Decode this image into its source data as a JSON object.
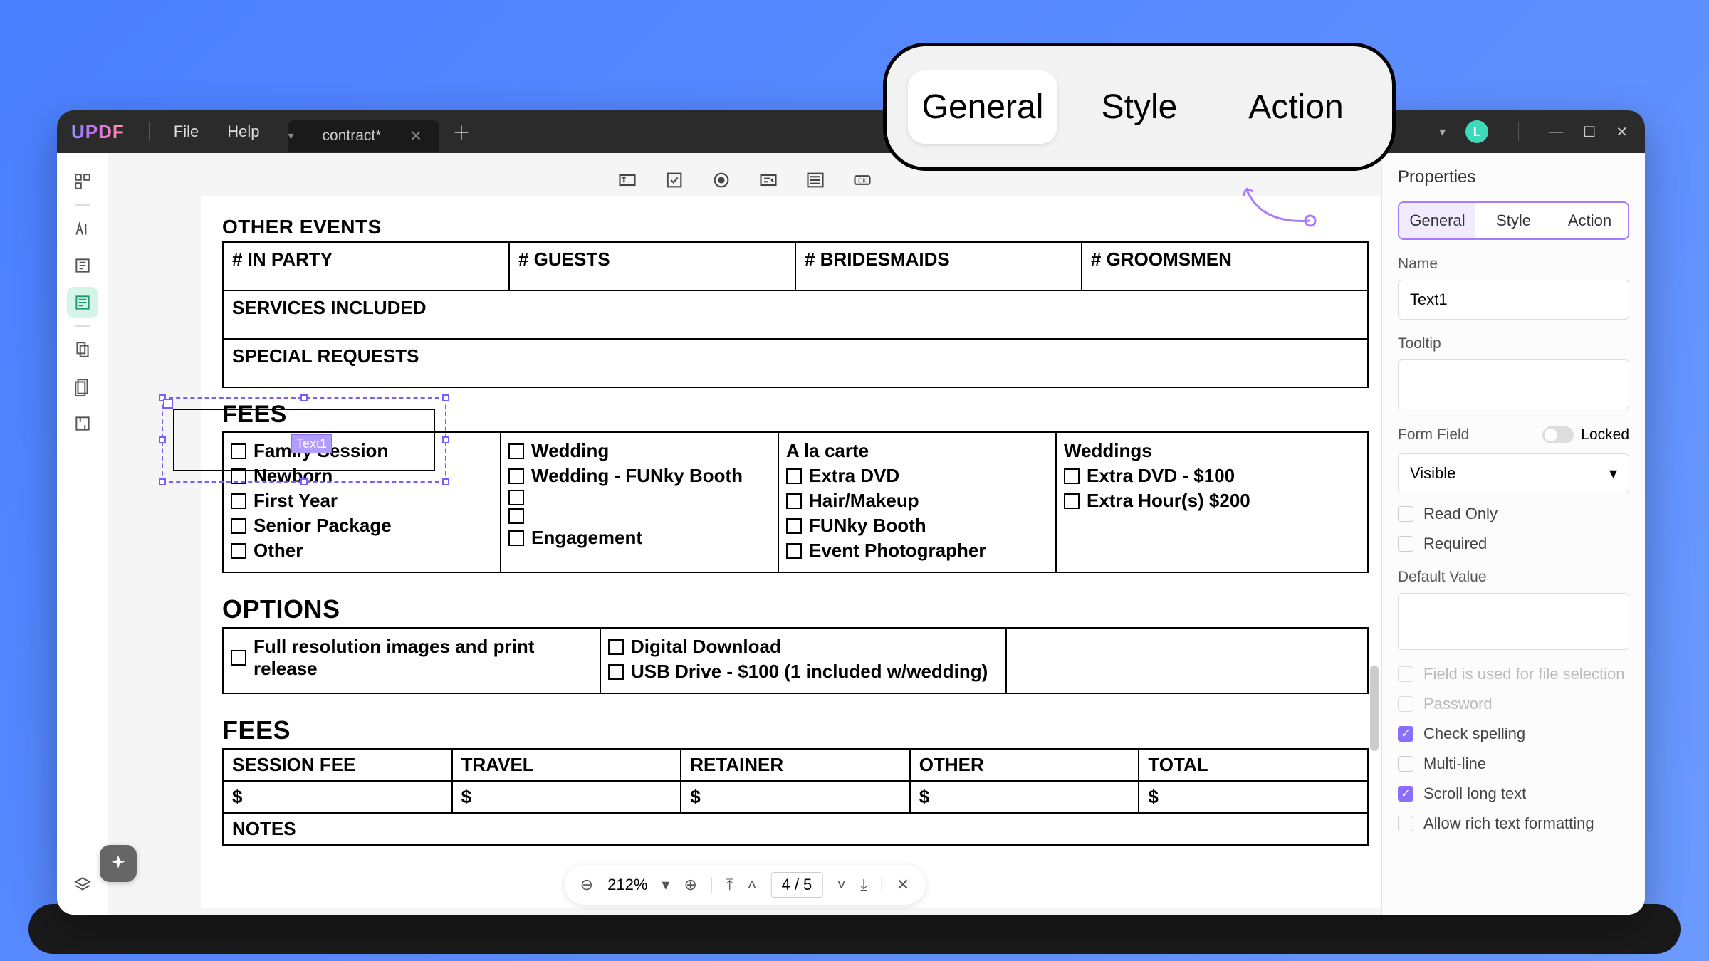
{
  "titlebar": {
    "logo": "UPDF",
    "menu_file": "File",
    "menu_help": "Help",
    "tab_name": "contract*",
    "avatar_letter": "L"
  },
  "callout": {
    "tab_general": "General",
    "tab_style": "Style",
    "tab_action": "Action"
  },
  "doc": {
    "other_events": "OTHER EVENTS",
    "in_party": "# IN PARTY",
    "guests": "# GUESTS",
    "bridesmaids": "# BRIDESMAIDS",
    "groomsmen": "# GROOMSMEN",
    "services": "SERVICES INCLUDED",
    "special": "SPECIAL REQUESTS",
    "fees_heading": "FEES",
    "selected_badge": "Text1",
    "col1": {
      "i1": "Family Session",
      "i2": "Newborn",
      "i3": "First Year",
      "i4": "Senior Package",
      "i5": "Other"
    },
    "col2": {
      "i1": "Wedding",
      "i2": "Wedding - FUNky Booth",
      "i3": "Engagement"
    },
    "col3": {
      "head": "A la carte",
      "i1": "Extra DVD",
      "i2": "Hair/Makeup",
      "i3": "FUNky Booth",
      "i4": "Event Photographer"
    },
    "col4": {
      "head": "Weddings",
      "i1": "Extra DVD - $100",
      "i2": "Extra Hour(s) $200"
    },
    "options_heading": "OPTIONS",
    "opt1": "Full resolution images and print release",
    "opt2": "Digital Download",
    "opt3": "USB Drive - $100 (1 included w/wedding)",
    "fees2_heading": "FEES",
    "session_fee": "SESSION FEE",
    "travel": "TRAVEL",
    "retainer": "RETAINER",
    "other": "OTHER",
    "total": "TOTAL",
    "dollar": "$",
    "notes": "NOTES"
  },
  "bottombar": {
    "zoom": "212%",
    "page": "4 / 5"
  },
  "panel": {
    "title": "Properties",
    "tab_general": "General",
    "tab_style": "Style",
    "tab_action": "Action",
    "name_label": "Name",
    "name_value": "Text1",
    "tooltip_label": "Tooltip",
    "formfield_label": "Form Field",
    "locked_label": "Locked",
    "visible_value": "Visible",
    "readonly": "Read Only",
    "required": "Required",
    "default_label": "Default Value",
    "file_select": "Field is used for file selection",
    "password": "Password",
    "spell": "Check spelling",
    "multiline": "Multi-line",
    "scroll": "Scroll long text",
    "richtext": "Allow rich text formatting"
  }
}
